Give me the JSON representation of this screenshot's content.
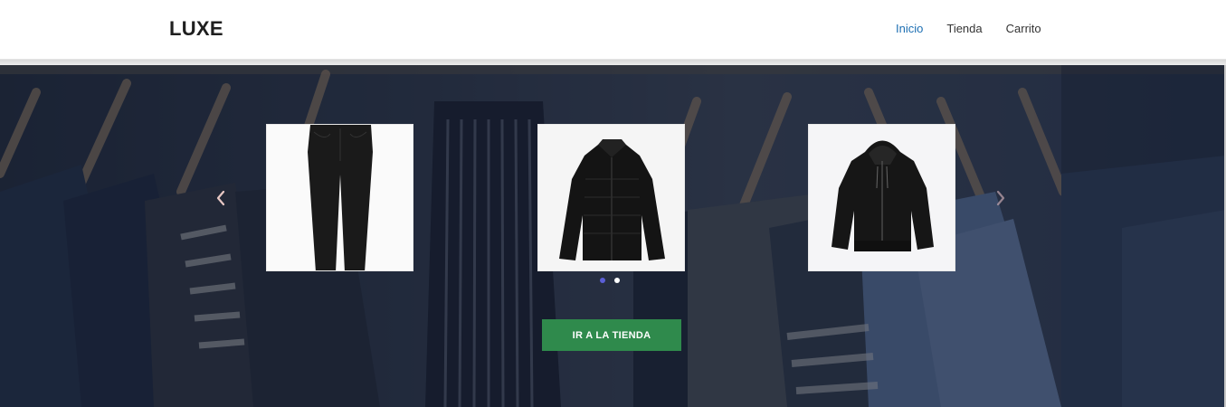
{
  "header": {
    "brand": "LUXE",
    "nav": [
      {
        "label": "Inicio",
        "active": true
      },
      {
        "label": "Tienda",
        "active": false
      },
      {
        "label": "Carrito",
        "active": false
      }
    ]
  },
  "hero": {
    "background_image": "clothing-rack-photo",
    "carousel": {
      "items": [
        {
          "product": "black-jeans-image"
        },
        {
          "product": "black-puffer-jacket-image"
        },
        {
          "product": "black-zip-hoodie-image"
        }
      ],
      "prev_icon": "chevron-left-icon",
      "next_icon": "chevron-right-icon",
      "pages": 2,
      "active_page": 1
    },
    "cta_label": "IR A LA TIENDA"
  },
  "colors": {
    "accent_link": "#1d6fb3",
    "cta": "#2f8a4c",
    "active_indicator": "#5b5fd6",
    "inactive_indicator": "#ffffff"
  }
}
